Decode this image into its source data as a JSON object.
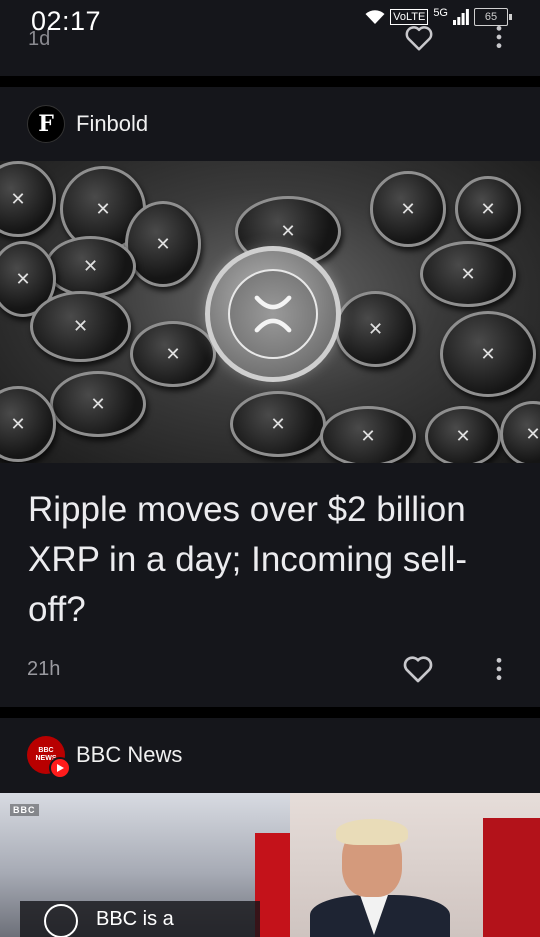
{
  "status_bar": {
    "time": "02:17",
    "network": "VoLTE",
    "signal_type": "5G",
    "battery": "65"
  },
  "previous_card": {
    "time": "1d"
  },
  "cards": [
    {
      "source": "Finbold",
      "logo_letter": "F",
      "headline": "Ripple moves over $2 billion XRP in a day; Incoming sell-off?",
      "time": "21h"
    },
    {
      "source": "BBC News",
      "logo_text_1": "BBC",
      "logo_text_2": "NEWS",
      "watermark": "BBC",
      "caption": "BBC is a"
    }
  ],
  "colors": {
    "background": "#000000",
    "card": "#15161b",
    "text_primary": "#ececef",
    "text_secondary": "#9a9aa0",
    "bbc_red": "#b80000"
  }
}
